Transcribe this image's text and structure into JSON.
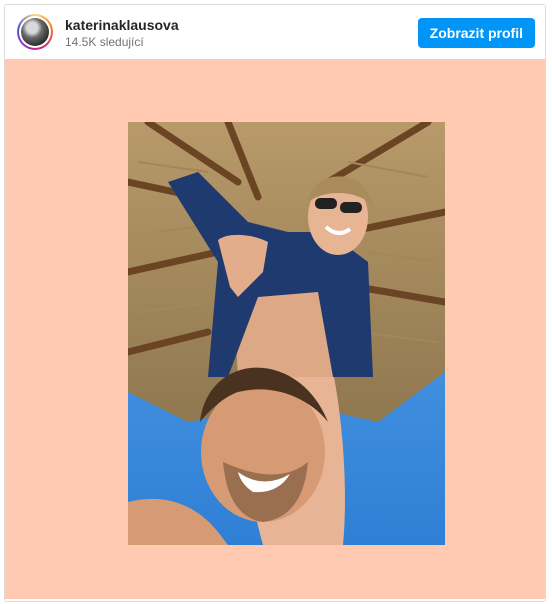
{
  "post": {
    "username": "katerinaklausova",
    "followers": "14.5K sledující",
    "view_profile_label": "Zobrazit profil"
  },
  "colors": {
    "button": "#0095f6",
    "media_background": "#ffcab1"
  },
  "icons": {
    "avatar": "profile-photo"
  }
}
